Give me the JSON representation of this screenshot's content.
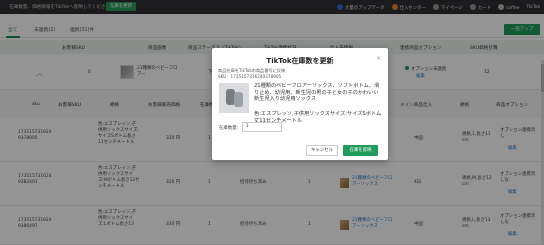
{
  "topbar": {
    "note": "在庫数量、価格情報をTikTokへ反映してください",
    "note_button": "在庫を更新",
    "nav": [
      "大量のアップデータ",
      "仕入センター",
      "マイページ",
      "カート",
      "coffee",
      "TikTok"
    ]
  },
  "tabs": {
    "items": [
      "全て",
      "未連携(2)",
      "連携(31)件"
    ],
    "bulk_button": "一括アップ"
  },
  "parent_header": {
    "columns": [
      "お客様SKU",
      "商品画像",
      "商品ステータス（TikTok）",
      "TikTok連携状況",
      "仕入先情報",
      "連携商品オプション",
      "SKU価格計算"
    ]
  },
  "parent_row": {
    "sku": "0",
    "product_name": "21種類のベビーフロアー",
    "status": "下書き",
    "option_label": "オプション未連携",
    "option_link": "編集",
    "count": "12"
  },
  "child_header": {
    "columns": [
      "sku",
      "お客様SKU",
      "規格",
      "お客様販売価格",
      "在庫数",
      "販売状況",
      "仕入先",
      "メイン商品仕入",
      "規格",
      "商品オプション"
    ]
  },
  "child_rows": [
    {
      "sku": "1735157316249378905",
      "variant": "色:エスプレッソ,子供用ソックスサイズ:サイズSポトム長さ11センチメートル",
      "price": "330 円",
      "stock": "1",
      "sales_status": "",
      "supplier": "",
      "source": "中国",
      "spec": "規格,1,長さ11 cm",
      "option": "オプション連携済し",
      "option_link": "編集"
    },
    {
      "sku": "1735157316249382401",
      "variant": "色:エスプレッソ,子供用ソックスサイズ:Mボトム長さ12センチメートル",
      "price": "330 円",
      "stock": "1",
      "sales_status": "招待待ち済み",
      "supplier": "21種類のベビーフロアーソックス",
      "source": "4日",
      "spec": "規格,M,長さ12 cm",
      "option": "オプション連携済しな",
      "option_link": "編集"
    },
    {
      "sku": "1735157316249386497",
      "variant": "色:エスプレッソ,子供用ソックスサイズ:Lボトム長さ13",
      "price": "330 円",
      "stock": "1",
      "sales_status": "招待待ち済み",
      "supplier": "21種類のベビーフロアーソックス",
      "source": "中国",
      "spec": "規格,L,長さ13 cm",
      "option": "オプション連携済しな",
      "option_link": "編集"
    }
  ],
  "modal": {
    "title": "TikTok在庫数を更新",
    "close": "×",
    "subtitle": "商品在庫をTikTokの商品番号に反映",
    "sku_line": "SKU：1735157316249378905",
    "product_name": "21種類のベビーフロアーソックス、ソフトボトム、滑り止め、幼児用、新生児の男の子と女の子のかわいい新生児入り幼児用ソックス",
    "variant": "色:エスプレッソ,子供用ソックスサイズ:サイズSボトム丈11センチメートル",
    "qty_label": "在庫数量：",
    "qty_value": "1",
    "cancel": "キャンセル",
    "update": "在庫を反映"
  }
}
